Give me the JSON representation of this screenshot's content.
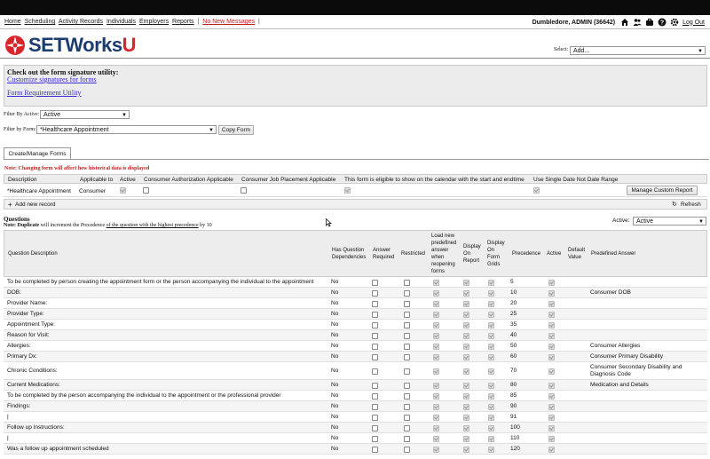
{
  "nav": {
    "links": [
      "Home",
      "Scheduling",
      "Activity Records",
      "Individuals",
      "Employers",
      "Reports"
    ],
    "messages": "No New Messages",
    "separator": "|",
    "user": "Dumbledore, ADMIN  (36642)",
    "logout": "Log Out"
  },
  "logo": {
    "main": "SETWorks",
    "accent": "U"
  },
  "select": {
    "label": "Select:",
    "value": "Add..."
  },
  "signature": {
    "title": "Check out the form signature utility:",
    "link1": "Customize signatures for forms",
    "link2": "Form Requirement Utility"
  },
  "filters": {
    "active_label": "Filter By Active:",
    "active_value": "Active",
    "form_label": "Filter by Form:",
    "form_value": "*Healthcare Appointment",
    "copy_button": "Copy Form"
  },
  "tab": "Create/Manage Forms",
  "warning": "Note: Changing form will affect how historical data is displayed",
  "form_table": {
    "headers": [
      "Description",
      "Applicable to",
      "Active",
      "Consumer Authorization Applicable",
      "Consumer Job Placement Applicable",
      "This form is eligible to show on the calendar with the start and endtime",
      "Use Single Date Not Date Range"
    ],
    "row": {
      "description": "*Healthcare Appointment",
      "applicable_to": "Consumer"
    },
    "manage_button": "Manage Custom Report",
    "add_record": "Add new record",
    "refresh": "Refresh"
  },
  "questions": {
    "title": "Questions",
    "note_prefix": "Note: ",
    "note_bold": "Duplicate",
    "note_mid": " will increment the Precedence ",
    "note_link": "of the question with the highest precedence",
    "note_end": " by 10",
    "active_label": "Active:",
    "active_value": "Active",
    "headers": {
      "description": "Question Description",
      "dependencies": [
        "Has Question",
        "Dependencies"
      ],
      "required": [
        "Answer",
        "Required"
      ],
      "restricted": "Restricted",
      "load": [
        "Load new",
        "predefined",
        "answer",
        "when",
        "reopening",
        "forms"
      ],
      "report": [
        "Display",
        "On",
        "Report"
      ],
      "grids": [
        "Display",
        "On",
        "Form",
        "Grids"
      ],
      "precedence": "Precedence",
      "active": "Active",
      "default": [
        "Default",
        "Value"
      ],
      "predefined": "Predefined Answer"
    },
    "rows": [
      {
        "desc": "To be completed by person creating the appointment form or the person accompanying the individual to the appointment",
        "dep": "No",
        "prec": "5",
        "pre": ""
      },
      {
        "desc": "DOB:",
        "dep": "No",
        "prec": "10",
        "pre": "Consumer DOB"
      },
      {
        "desc": "Provider Name:",
        "dep": "No",
        "prec": "20",
        "pre": ""
      },
      {
        "desc": "Provider Type:",
        "dep": "No",
        "prec": "25",
        "pre": ""
      },
      {
        "desc": "Appointment Type:",
        "dep": "No",
        "prec": "35",
        "pre": ""
      },
      {
        "desc": "Reason for Visit:",
        "dep": "No",
        "prec": "40",
        "pre": ""
      },
      {
        "desc": "Allergies:",
        "dep": "No",
        "prec": "50",
        "pre": "Consumer Allergies"
      },
      {
        "desc": "Primary Dx:",
        "dep": "No",
        "prec": "60",
        "pre": "Consumer Primary Disability"
      },
      {
        "desc": "Chronic Conditions:",
        "dep": "No",
        "prec": "70",
        "pre": "Consumer Secondary Disability and Diagnosis Code"
      },
      {
        "desc": "Current Medications:",
        "dep": "No",
        "prec": "80",
        "pre": "Medication and Details"
      },
      {
        "desc": "To be completed by the person accompanying the individual to the appointment or the professional provider",
        "dep": "No",
        "prec": "85",
        "pre": ""
      },
      {
        "desc": "Findings:",
        "dep": "No",
        "prec": "90",
        "pre": ""
      },
      {
        "desc": "|",
        "dep": "No",
        "prec": "91",
        "pre": ""
      },
      {
        "desc": "Follow up Instructions:",
        "dep": "No",
        "prec": "100",
        "pre": ""
      },
      {
        "desc": "|",
        "dep": "No",
        "prec": "110",
        "pre": ""
      },
      {
        "desc": "Was a follow up appointment scheduled",
        "dep": "No",
        "prec": "120",
        "pre": ""
      }
    ]
  },
  "colors": {
    "brand_blue": "#1d3c6e",
    "brand_red": "#d8262a",
    "warning": "#c21d1d",
    "link": "#3a2ed0"
  }
}
